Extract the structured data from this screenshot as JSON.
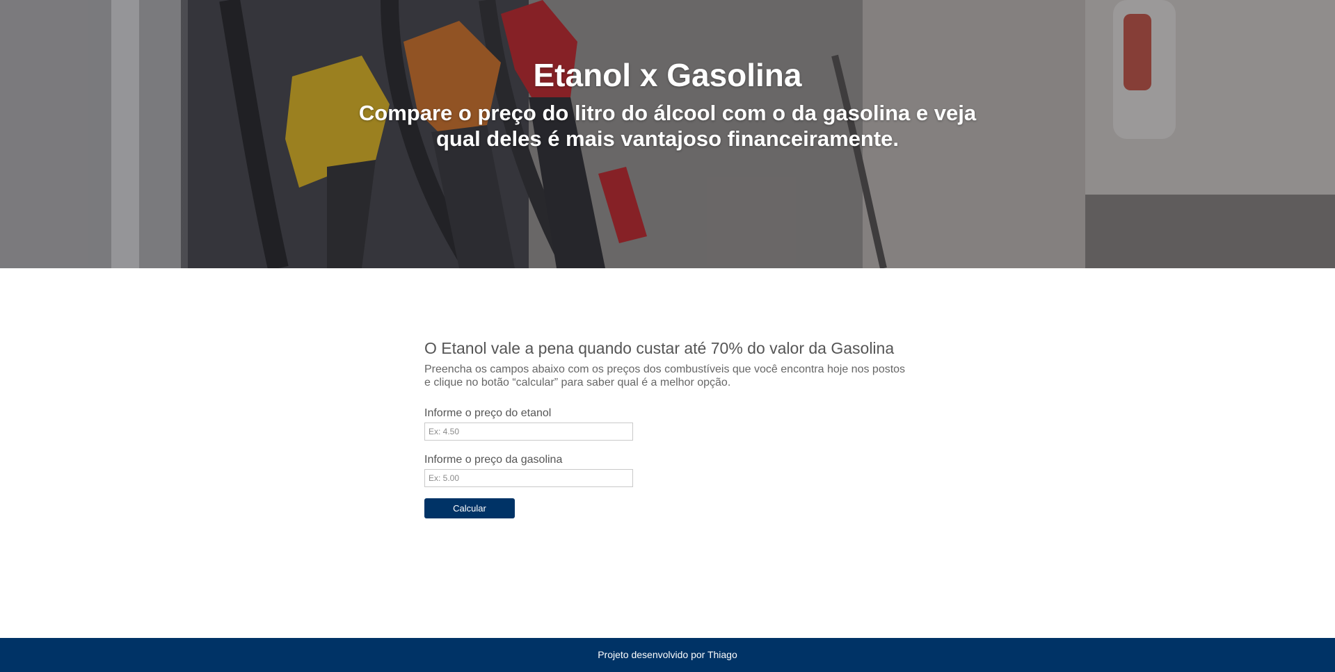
{
  "hero": {
    "title": "Etanol x Gasolina",
    "subtitle": "Compare o preço do litro do álcool com o da gasolina e veja qual deles é mais vantajoso financeiramente.",
    "image": "fuel-pump-nozzles-photo"
  },
  "main": {
    "heading": "O Etanol vale a pena quando custar até 70% do valor da Gasolina",
    "description": "Preencha os campos abaixo com os preços dos combustíveis que você encontra hoje nos postos e clique no botão “calcular” para saber qual é a melhor opção.",
    "ethanol": {
      "label": "Informe o preço do etanol",
      "placeholder": "Ex: 4.50",
      "value": ""
    },
    "gasoline": {
      "label": "Informe o preço da gasolina",
      "placeholder": "Ex: 5.00",
      "value": ""
    },
    "button_label": "Calcular"
  },
  "footer": {
    "text": "Projeto desenvolvido por Thiago"
  },
  "colors": {
    "brand": "#003366",
    "text": "#555555",
    "hero_text": "#ffffff"
  }
}
